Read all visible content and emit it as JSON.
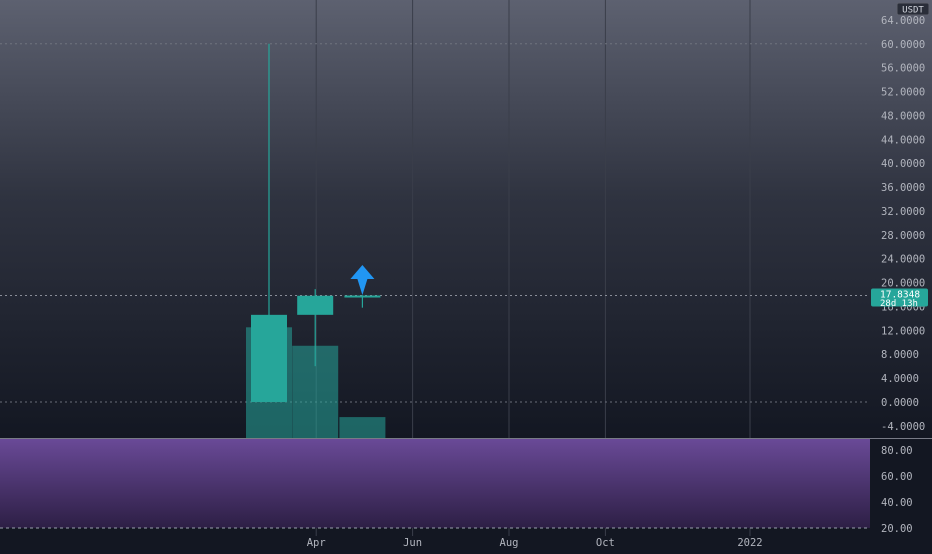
{
  "chart_data": [
    {
      "type": "candlestick",
      "title": "",
      "currency": "USDT",
      "y_ticks": [
        -4,
        0,
        4,
        8,
        12,
        16,
        20,
        24,
        28,
        32,
        36,
        40,
        44,
        48,
        52,
        56,
        60,
        64
      ],
      "y_tick_labels": [
        "-4.0000",
        "0.0000",
        "4.0000",
        "8.0000",
        "12.0000",
        "16.0000",
        "20.0000",
        "24.0000",
        "28.0000",
        "32.0000",
        "36.0000",
        "40.0000",
        "44.0000",
        "48.0000",
        "52.0000",
        "56.0000",
        "60.0000",
        "64.0000"
      ],
      "ylim": [
        -6,
        67
      ],
      "x_labels": [
        "Apr",
        "Jun",
        "Aug",
        "Oct",
        "2022"
      ],
      "x_label_months": [
        3,
        5,
        7,
        9,
        12
      ],
      "candles": [
        {
          "month": 2,
          "open": 0.0,
          "high": 60.0,
          "low": 0.0,
          "close": 14.6,
          "volume": 0.9
        },
        {
          "month": 3,
          "open": 14.6,
          "high": 18.9,
          "low": 6.0,
          "close": 17.8,
          "volume": 0.75
        },
        {
          "month": 4,
          "open": 17.8,
          "high": 17.9,
          "low": 15.8,
          "close": 17.8348,
          "volume": 0.17
        }
      ],
      "last_price": "17.8348",
      "countdown": "28d 13h",
      "arrow_marker": {
        "month": 4,
        "direction": "up",
        "color": "#2196f3"
      },
      "candle_color": "#26a69a",
      "volume_color": "#26a69a",
      "grid": true
    },
    {
      "type": "line",
      "title": "",
      "y_ticks": [
        20,
        40,
        60,
        80
      ],
      "y_tick_labels": [
        "20.00",
        "40.00",
        "60.00",
        "80.00"
      ],
      "ylim": [
        16,
        88
      ],
      "bands": [
        20,
        80
      ],
      "fill_color": "#7e57c2"
    }
  ]
}
